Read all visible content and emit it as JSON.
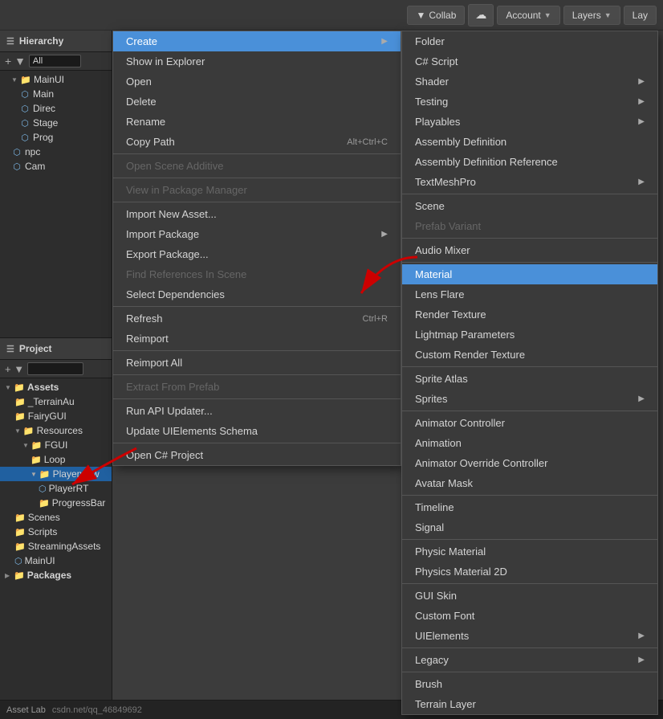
{
  "topbar": {
    "collab_label": "Collab",
    "account_label": "Account",
    "layers_label": "Layers",
    "lay_label": "Lay"
  },
  "hierarchy": {
    "title": "Hierarchy",
    "search_placeholder": "All",
    "items": [
      {
        "id": "mainui",
        "label": "MainUI",
        "level": 1,
        "type": "folder",
        "expanded": true
      },
      {
        "id": "main",
        "label": "Main",
        "level": 2,
        "type": "gameobj"
      },
      {
        "id": "direc",
        "label": "Direc",
        "level": 2,
        "type": "gameobj"
      },
      {
        "id": "stage",
        "label": "Stage",
        "level": 2,
        "type": "gameobj"
      },
      {
        "id": "prog",
        "label": "Prog",
        "level": 2,
        "type": "gameobj"
      },
      {
        "id": "npc",
        "label": "npc",
        "level": 1,
        "type": "gameobj"
      },
      {
        "id": "cam",
        "label": "Cam",
        "level": 1,
        "type": "gameobj"
      }
    ]
  },
  "context_menu_left": {
    "items": [
      {
        "id": "create",
        "label": "Create",
        "type": "submenu",
        "highlighted": true
      },
      {
        "id": "show_explorer",
        "label": "Show in Explorer",
        "type": "item"
      },
      {
        "id": "open",
        "label": "Open",
        "type": "item"
      },
      {
        "id": "delete",
        "label": "Delete",
        "type": "item"
      },
      {
        "id": "rename",
        "label": "Rename",
        "type": "item"
      },
      {
        "id": "copy_path",
        "label": "Copy Path",
        "shortcut": "Alt+Ctrl+C",
        "type": "item"
      },
      {
        "id": "sep1",
        "type": "separator"
      },
      {
        "id": "open_scene",
        "label": "Open Scene Additive",
        "type": "item",
        "disabled": true
      },
      {
        "id": "sep2",
        "type": "separator"
      },
      {
        "id": "view_package",
        "label": "View in Package Manager",
        "type": "item",
        "disabled": true
      },
      {
        "id": "sep3",
        "type": "separator"
      },
      {
        "id": "import_asset",
        "label": "Import New Asset...",
        "type": "item"
      },
      {
        "id": "import_package",
        "label": "Import Package",
        "type": "submenu"
      },
      {
        "id": "export_package",
        "label": "Export Package...",
        "type": "item"
      },
      {
        "id": "find_refs",
        "label": "Find References In Scene",
        "type": "item",
        "disabled": true
      },
      {
        "id": "select_deps",
        "label": "Select Dependencies",
        "type": "item"
      },
      {
        "id": "sep4",
        "type": "separator"
      },
      {
        "id": "refresh",
        "label": "Refresh",
        "shortcut": "Ctrl+R",
        "type": "item"
      },
      {
        "id": "reimport",
        "label": "Reimport",
        "type": "item"
      },
      {
        "id": "sep5",
        "type": "separator"
      },
      {
        "id": "reimport_all",
        "label": "Reimport All",
        "type": "item"
      },
      {
        "id": "sep6",
        "type": "separator"
      },
      {
        "id": "extract_prefab",
        "label": "Extract From Prefab",
        "type": "item",
        "disabled": true
      },
      {
        "id": "sep7",
        "type": "separator"
      },
      {
        "id": "run_api",
        "label": "Run API Updater...",
        "type": "item"
      },
      {
        "id": "update_schema",
        "label": "Update UIElements Schema",
        "type": "item"
      },
      {
        "id": "sep8",
        "type": "separator"
      },
      {
        "id": "open_csharp",
        "label": "Open C# Project",
        "type": "item"
      }
    ]
  },
  "context_menu_right": {
    "items": [
      {
        "id": "folder",
        "label": "Folder",
        "type": "item"
      },
      {
        "id": "csharp",
        "label": "C# Script",
        "type": "item"
      },
      {
        "id": "shader",
        "label": "Shader",
        "type": "submenu"
      },
      {
        "id": "testing",
        "label": "Testing",
        "type": "submenu"
      },
      {
        "id": "playables",
        "label": "Playables",
        "type": "submenu"
      },
      {
        "id": "assembly_def",
        "label": "Assembly Definition",
        "type": "item"
      },
      {
        "id": "assembly_def_ref",
        "label": "Assembly Definition Reference",
        "type": "item"
      },
      {
        "id": "textmeshpro",
        "label": "TextMeshPro",
        "type": "submenu"
      },
      {
        "id": "sep1",
        "type": "separator"
      },
      {
        "id": "scene",
        "label": "Scene",
        "type": "item"
      },
      {
        "id": "prefab_variant",
        "label": "Prefab Variant",
        "type": "item",
        "disabled": true
      },
      {
        "id": "sep2",
        "type": "separator"
      },
      {
        "id": "audio_mixer",
        "label": "Audio Mixer",
        "type": "item"
      },
      {
        "id": "sep3",
        "type": "separator"
      },
      {
        "id": "material",
        "label": "Material",
        "type": "item",
        "highlighted": true
      },
      {
        "id": "lens_flare",
        "label": "Lens Flare",
        "type": "item"
      },
      {
        "id": "render_texture",
        "label": "Render Texture",
        "type": "item"
      },
      {
        "id": "lightmap_params",
        "label": "Lightmap Parameters",
        "type": "item"
      },
      {
        "id": "custom_render",
        "label": "Custom Render Texture",
        "type": "item"
      },
      {
        "id": "sep4",
        "type": "separator"
      },
      {
        "id": "sprite_atlas",
        "label": "Sprite Atlas",
        "type": "item"
      },
      {
        "id": "sprites",
        "label": "Sprites",
        "type": "submenu"
      },
      {
        "id": "sep5",
        "type": "separator"
      },
      {
        "id": "animator_ctrl",
        "label": "Animator Controller",
        "type": "item"
      },
      {
        "id": "animation",
        "label": "Animation",
        "type": "item"
      },
      {
        "id": "animator_override",
        "label": "Animator Override Controller",
        "type": "item"
      },
      {
        "id": "avatar_mask",
        "label": "Avatar Mask",
        "type": "item"
      },
      {
        "id": "sep6",
        "type": "separator"
      },
      {
        "id": "timeline",
        "label": "Timeline",
        "type": "item"
      },
      {
        "id": "signal",
        "label": "Signal",
        "type": "item"
      },
      {
        "id": "sep7",
        "type": "separator"
      },
      {
        "id": "physic_material",
        "label": "Physic Material",
        "type": "item"
      },
      {
        "id": "physics_2d",
        "label": "Physics Material 2D",
        "type": "item"
      },
      {
        "id": "sep8",
        "type": "separator"
      },
      {
        "id": "gui_skin",
        "label": "GUI Skin",
        "type": "item"
      },
      {
        "id": "custom_font",
        "label": "Custom Font",
        "type": "item"
      },
      {
        "id": "ui_elements",
        "label": "UIElements",
        "type": "submenu"
      },
      {
        "id": "sep9",
        "type": "separator"
      },
      {
        "id": "legacy",
        "label": "Legacy",
        "type": "submenu"
      },
      {
        "id": "sep10",
        "type": "separator"
      },
      {
        "id": "brush",
        "label": "Brush",
        "type": "item"
      },
      {
        "id": "terrain_layer",
        "label": "Terrain Layer",
        "type": "item"
      }
    ]
  },
  "project": {
    "title": "Project",
    "items": [
      {
        "id": "assets",
        "label": "Assets",
        "level": 0,
        "type": "folder",
        "expanded": true
      },
      {
        "id": "terrainau",
        "label": "_TerrainAu",
        "level": 1,
        "type": "folder"
      },
      {
        "id": "fairygui",
        "label": "FairyGUI",
        "level": 1,
        "type": "folder"
      },
      {
        "id": "resources",
        "label": "Resources",
        "level": 1,
        "type": "folder",
        "expanded": true
      },
      {
        "id": "fgui",
        "label": "FGUI",
        "level": 2,
        "type": "folder",
        "expanded": true
      },
      {
        "id": "loop",
        "label": "Loop",
        "level": 3,
        "type": "folder"
      },
      {
        "id": "playerview",
        "label": "Playerview",
        "level": 3,
        "type": "folder",
        "selected": true
      },
      {
        "id": "playerrt",
        "label": "PlayerRT",
        "level": 4,
        "type": "asset"
      },
      {
        "id": "progressbar",
        "label": "ProgressBar",
        "level": 4,
        "type": "folder"
      },
      {
        "id": "scenes",
        "label": "Scenes",
        "level": 1,
        "type": "folder"
      },
      {
        "id": "scripts",
        "label": "Scripts",
        "level": 1,
        "type": "folder"
      },
      {
        "id": "streaming",
        "label": "StreamingAssets",
        "level": 1,
        "type": "folder"
      },
      {
        "id": "mainui_asset",
        "label": "MainUI",
        "level": 1,
        "type": "asset"
      },
      {
        "id": "packages",
        "label": "Packages",
        "level": 0,
        "type": "folder"
      }
    ]
  },
  "statusbar": {
    "asset_label": "Asset Lab"
  },
  "colors": {
    "highlight_blue": "#4a90d9",
    "folder_yellow": "#e8c456",
    "gameobj_blue": "#7ab3e0",
    "disabled_gray": "#666666",
    "separator": "#555555",
    "menu_bg": "#3a3a3a",
    "panel_bg": "#2d2d2d"
  }
}
